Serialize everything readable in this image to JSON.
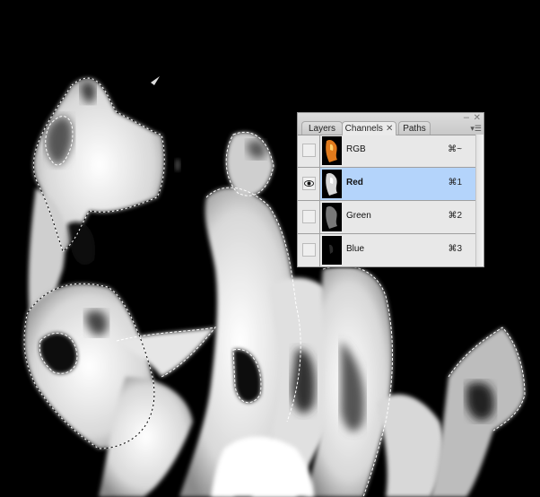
{
  "canvas": {
    "description": "Grayscale fire image (Red channel) with active marching-ants selection",
    "background": "#000000"
  },
  "panel": {
    "tabs": [
      {
        "label": "Layers",
        "active": false
      },
      {
        "label": "Channels",
        "active": true,
        "close_glyph": "✕"
      },
      {
        "label": "Paths",
        "active": false
      }
    ],
    "window_controls": {
      "minimize": "–",
      "close": "✕",
      "menu": "▾☰"
    },
    "channels": [
      {
        "name": "RGB",
        "shortcut": "⌘~",
        "visible": false,
        "selected": false,
        "thumb": "color"
      },
      {
        "name": "Red",
        "shortcut": "⌘1",
        "visible": true,
        "selected": true,
        "thumb": "bright"
      },
      {
        "name": "Green",
        "shortcut": "⌘2",
        "visible": false,
        "selected": false,
        "thumb": "medium"
      },
      {
        "name": "Blue",
        "shortcut": "⌘3",
        "visible": false,
        "selected": false,
        "thumb": "dark"
      }
    ],
    "colors": {
      "selected_row": "#b4d4fb",
      "panel_bg": "#e8e8e8"
    }
  }
}
